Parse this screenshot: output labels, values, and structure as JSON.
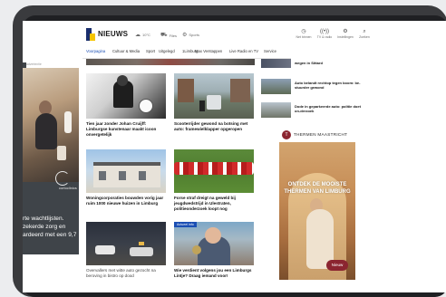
{
  "site": {
    "logo_text": "NIEUWS",
    "weather": [
      {
        "icon": "cloud-sun-icon",
        "value": "10°C"
      },
      {
        "icon": "car-icon",
        "value": "Files"
      },
      {
        "icon": "train-icon",
        "value": "Sports"
      }
    ],
    "header_icons": [
      {
        "icon": "clock-icon",
        "label": "Net binnen"
      },
      {
        "icon": "broadcast-icon",
        "label": "TV & radio"
      },
      {
        "icon": "gear-icon",
        "label": "Instellingen"
      },
      {
        "icon": "search-icon",
        "label": "Zoeken"
      }
    ]
  },
  "nav": {
    "items": [
      "Voorpagina",
      "Cultuur & Media",
      "Sport",
      "Uitgelegd",
      "1Limburg",
      "Max Verstappen",
      "Live Radio en TV",
      "Service"
    ],
    "active": "Voorpagina"
  },
  "left_ad": {
    "label": "advertentie",
    "brand": "cortoclinics",
    "text": "rte wachtlijsten. zekerde zorg en ardeerd met een 9,7"
  },
  "cards": [
    {
      "caption": "Tien jaar zonder Johan Cruijff: Limburgse kunstenaar maakt icoon onvergetelijk",
      "badge": ""
    },
    {
      "caption": "Scooterrijder gewond na botsing met auto: framewielklapper opgeropen",
      "badge": ""
    },
    {
      "caption": "Woningcorporaties bouwden vorig jaar ruim 1000 nieuwe huizen in Limburg",
      "badge": ""
    },
    {
      "caption": "Forse straf dreigt na geweld bij jeugdwedstrijd in Ulestraten, politieonderzoek loopt nog",
      "badge": ""
    },
    {
      "caption": "Overvallers met witte auto gezocht na beroving in bistro op dood",
      "badge": ""
    },
    {
      "caption": "Wie verdient volgens jou een Limburgs Lintje? Draag iemand voor!",
      "badge": "Actueel info"
    }
  ],
  "right_list": [
    {
      "title": "wegen in Sittard"
    },
    {
      "title": "Auto belandt rechtop tegen boom: be-stuurder gewond"
    },
    {
      "title": "Dode in geparkeerde auto: politie doet on-derzoek"
    }
  ],
  "right_ad": {
    "brand": "THERMEN MAASTRICHT",
    "slogan": "ONTDEK DE MOOISTE THERMEN VAN LIMBURG",
    "cta": "Nieuw"
  }
}
